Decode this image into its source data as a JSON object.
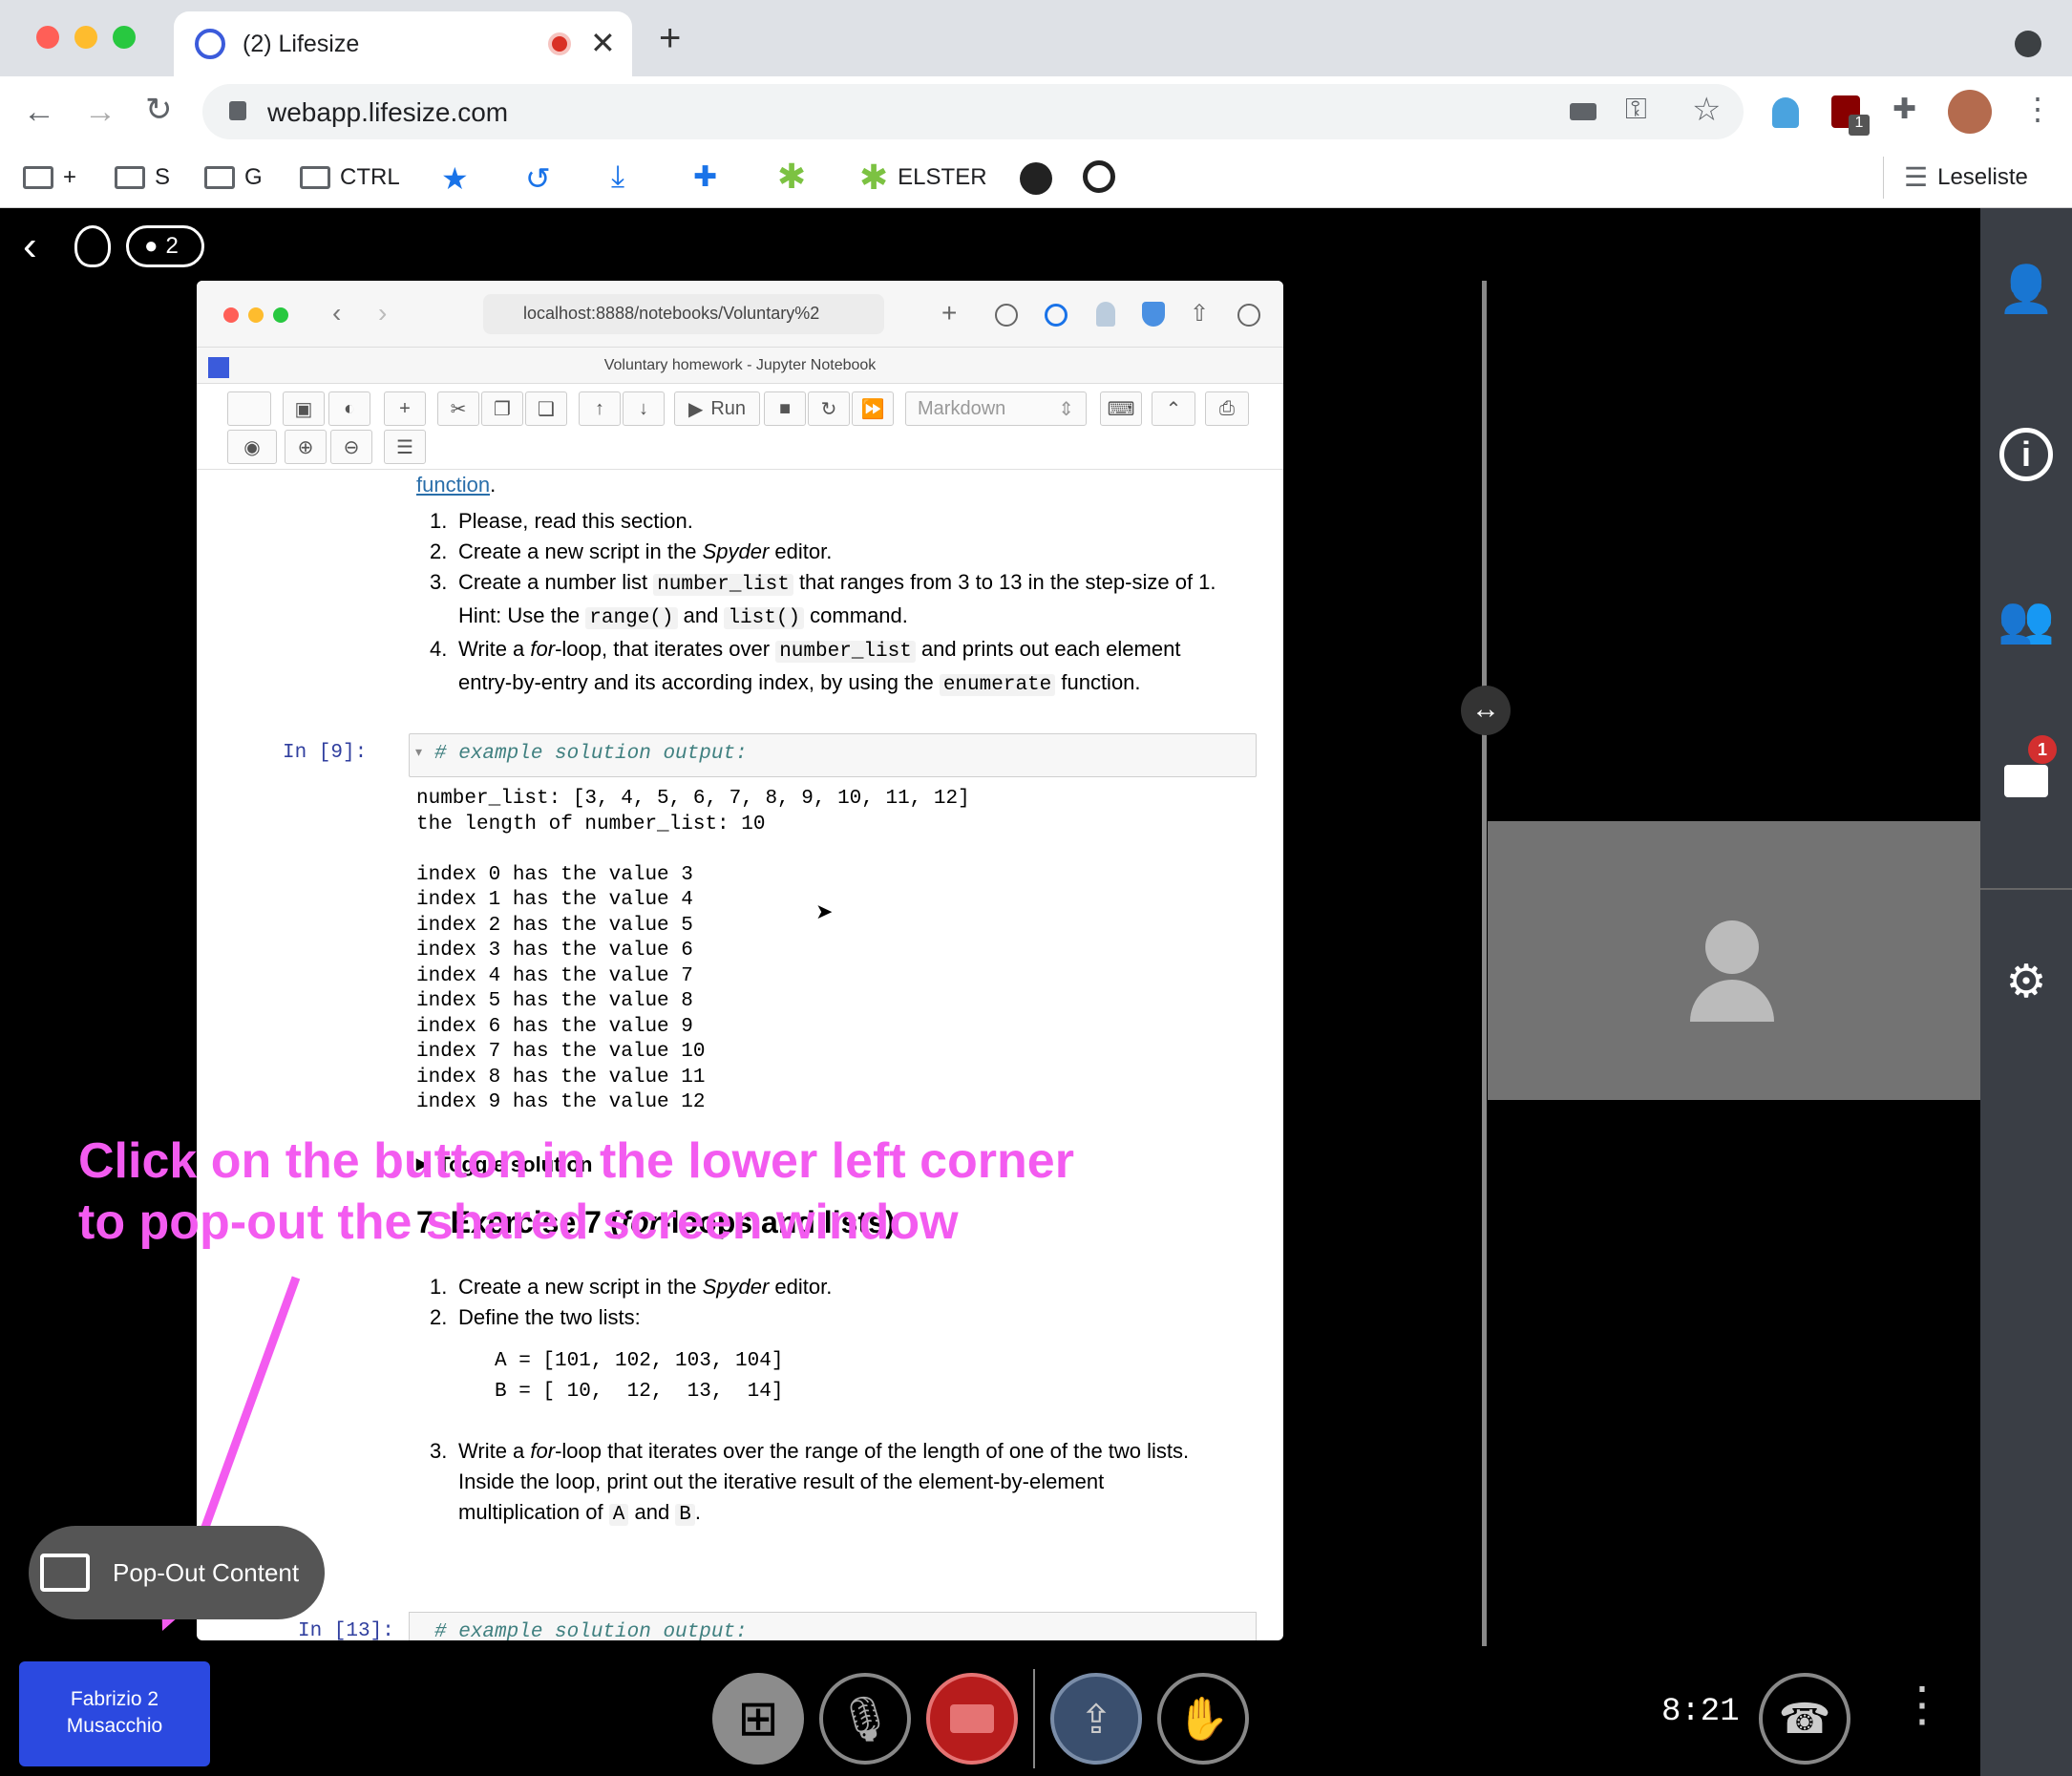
{
  "tab": {
    "title": "(2) Lifesize"
  },
  "address": {
    "url": "webapp.lifesize.com"
  },
  "bookmarks": [
    {
      "label": "+"
    },
    {
      "label": "S"
    },
    {
      "label": "G"
    },
    {
      "label": "CTRL"
    },
    {
      "label": "ELSTER"
    }
  ],
  "reading_list": "Leseliste",
  "extension_badge": "1",
  "meeting": {
    "participant_count": "2",
    "chat_badge": "1",
    "time": "8:21",
    "user_line1": "Fabrizio 2",
    "user_line2": "Musacchio",
    "popout_label": "Pop-Out Content"
  },
  "annotation": {
    "line1": "Click on the button in the lower left corner",
    "line2": "to pop-out the shared screen window"
  },
  "shared": {
    "url": "localhost:8888/notebooks/Voluntary%2",
    "title": "Voluntary homework - Jupyter Notebook",
    "run_label": "Run",
    "cell_type": "Markdown",
    "link_text": "function",
    "intro_items": [
      "Please, read this section.",
      "Create a new script in the ",
      "Create a number list ",
      "Write a "
    ],
    "item2_em": "Spyder",
    "item2_end": " editor.",
    "item3_code": "number_list",
    "item3_mid": " that ranges from 3 to 13 in the step-size of 1.",
    "item3_hint": "Hint: Use the ",
    "item3_code2": "range()",
    "item3_and": " and ",
    "item3_code3": "list()",
    "item3_end": " command.",
    "item4_em": "for",
    "item4_mid": "-loop, that iterates over ",
    "item4_code": "number_list",
    "item4_end": " and prints out each element",
    "item4_line2": "entry-by-entry and its according index, by using the ",
    "item4_code2": "enumerate",
    "item4_end2": " function.",
    "prompt": "In [9]:",
    "cell_code": "# example solution output:",
    "output": "number_list: [3, 4, 5, 6, 7, 8, 9, 10, 11, 12]\nthe length of number_list: 10\n\nindex 0 has the value 3\nindex 1 has the value 4\nindex 2 has the value 5\nindex 3 has the value 6\nindex 4 has the value 7\nindex 5 has the value 8\nindex 6 has the value 9\nindex 7 has the value 10\nindex 8 has the value 11\nindex 9 has the value 12",
    "toggle": "Toggle solution",
    "ex_num": "7",
    "ex_title1": "Exercise 7 (",
    "ex_em": "for",
    "ex_title2": "-loops and lists)",
    "ex_items": [
      "Create a new script in the ",
      "Define the two lists:"
    ],
    "lists_code": "A = [101, 102, 103, 104]\nB = [ 10,  12,  13,  14]",
    "ex3_a": "Write a ",
    "ex3_em": "for",
    "ex3_b": "-loop that iterates over the range of the length of one of the two lists.",
    "ex3_line2": "Inside the loop, print out the iterative result of the element-by-element",
    "ex3_line3": "multiplication of ",
    "ex3_A": "A",
    "ex3_and": " and ",
    "ex3_B": "B",
    "ex3_end": ".",
    "next_prompt": "In [13]:",
    "next_code": "# example solution output:"
  }
}
